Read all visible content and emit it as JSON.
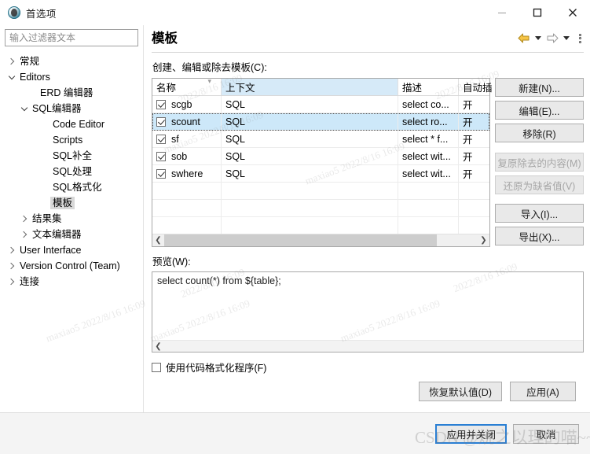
{
  "window": {
    "title": "首选项",
    "icon": "dbeaver-app-icon",
    "controls": {
      "minimize": "minimize-icon",
      "maximize": "maximize-icon",
      "close": "close-icon"
    }
  },
  "sidebar": {
    "filter": {
      "placeholder": "输入过滤器文本",
      "value": ""
    },
    "items": [
      {
        "label": "常规",
        "depth": 0,
        "twist": "right",
        "selected": false
      },
      {
        "label": "Editors",
        "depth": 0,
        "twist": "down",
        "selected": false
      },
      {
        "label": "ERD 编辑器",
        "depth": 2,
        "twist": "none",
        "selected": false
      },
      {
        "label": "SQL编辑器",
        "depth": 1,
        "twist": "down",
        "selected": false
      },
      {
        "label": "Code Editor",
        "depth": 3,
        "twist": "none",
        "selected": false
      },
      {
        "label": "Scripts",
        "depth": 3,
        "twist": "none",
        "selected": false
      },
      {
        "label": "SQL补全",
        "depth": 3,
        "twist": "none",
        "selected": false
      },
      {
        "label": "SQL处理",
        "depth": 3,
        "twist": "none",
        "selected": false
      },
      {
        "label": "SQL格式化",
        "depth": 3,
        "twist": "none",
        "selected": false
      },
      {
        "label": "模板",
        "depth": 3,
        "twist": "none",
        "selected": true
      },
      {
        "label": "结果集",
        "depth": 1,
        "twist": "right",
        "selected": false
      },
      {
        "label": "文本编辑器",
        "depth": 1,
        "twist": "right",
        "selected": false
      },
      {
        "label": "User Interface",
        "depth": 0,
        "twist": "right",
        "selected": false
      },
      {
        "label": "Version Control (Team)",
        "depth": 0,
        "twist": "right",
        "selected": false
      },
      {
        "label": "连接",
        "depth": 0,
        "twist": "right",
        "selected": false
      }
    ]
  },
  "page": {
    "title": "模板",
    "section_label": "创建、编辑或除去模板(C):",
    "nav": {
      "back": "back-arrow-icon",
      "back_menu": "back-dropdown-icon",
      "forward": "forward-arrow-icon",
      "forward_menu": "forward-dropdown-icon",
      "menu": "view-menu-icon"
    }
  },
  "table": {
    "columns": [
      {
        "key": "name",
        "label": "名称",
        "sorted": true,
        "highlighted": false
      },
      {
        "key": "context",
        "label": "上下文",
        "sorted": false,
        "highlighted": true
      },
      {
        "key": "description",
        "label": "描述",
        "sorted": false,
        "highlighted": false
      },
      {
        "key": "auto",
        "label": "自动插",
        "sorted": false,
        "highlighted": false
      }
    ],
    "rows": [
      {
        "checked": true,
        "name": "scgb",
        "context": "SQL",
        "description": "select co...",
        "auto": "开",
        "selected": false
      },
      {
        "checked": true,
        "name": "scount",
        "context": "SQL",
        "description": "select ro...",
        "auto": "开",
        "selected": true
      },
      {
        "checked": true,
        "name": "sf",
        "context": "SQL",
        "description": "select * f...",
        "auto": "开",
        "selected": false
      },
      {
        "checked": true,
        "name": "sob",
        "context": "SQL",
        "description": "select wit...",
        "auto": "开",
        "selected": false
      },
      {
        "checked": true,
        "name": "swhere",
        "context": "SQL",
        "description": "select wit...",
        "auto": "开",
        "selected": false
      }
    ],
    "scroll_left_icon": "scroll-left-icon",
    "scroll_right_icon": "scroll-right-icon"
  },
  "side_buttons": [
    {
      "label": "新建(N)...",
      "name": "new-button",
      "enabled": true
    },
    {
      "label": "编辑(E)...",
      "name": "edit-button",
      "enabled": true
    },
    {
      "label": "移除(R)",
      "name": "remove-button",
      "enabled": true
    },
    {
      "label": "复原除去的内容(M)",
      "name": "restore-removed-button",
      "enabled": false
    },
    {
      "label": "还原为缺省值(V)",
      "name": "restore-defaults-button",
      "enabled": false
    },
    {
      "label": "导入(I)...",
      "name": "import-button",
      "enabled": true
    },
    {
      "label": "导出(X)...",
      "name": "export-button",
      "enabled": true
    }
  ],
  "preview": {
    "label": "预览(W):",
    "content": "select count(*) from ${table};",
    "scroll_left_icon": "scroll-left-icon"
  },
  "format_checkbox": {
    "label": "使用代码格式化程序(F)",
    "checked": false
  },
  "apply_bar": {
    "restore_defaults": "恢复默认值(D)",
    "apply": "应用(A)"
  },
  "footer": {
    "apply_and_close": "应用并关闭",
    "cancel": "取消"
  },
  "watermarks": {
    "w1": "maxiao5 2022/8/16 16:09",
    "w2": "maxiao5 2022/8/16 16:09",
    "w3": "maxiao5 2022/8/16 16:09",
    "w4": "maxiao5 2022/8/16 16:09",
    "w5": "maxiao5 2022/8/16 16:09",
    "w6": "2022/8/16 16:09",
    "csdn": "CSDN @烧之以理的喵~~~"
  },
  "colors": {
    "accent": "#2a7fd4",
    "selection": "#cde8f9",
    "header_highlight": "#d6eaf8",
    "button_face": "#e9e9e9"
  }
}
